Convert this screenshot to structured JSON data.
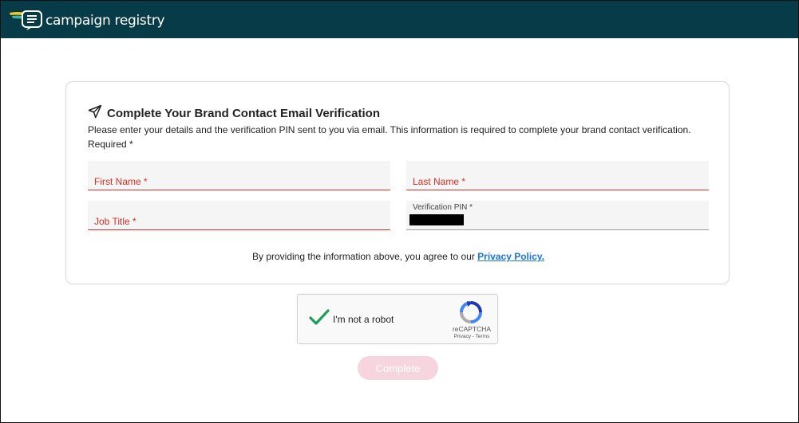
{
  "header": {
    "logo_text": "campaign registry"
  },
  "form": {
    "title": "Complete Your Brand Contact Email Verification",
    "description": "Please enter your details and the verification PIN sent to you via email. This information is required to complete your brand contact verification.",
    "required_note": "Required *",
    "fields": {
      "first_name": "First Name *",
      "last_name": "Last Name *",
      "job_title": "Job Title *",
      "verification_pin": "Verification PIN *"
    },
    "agree_text": "By providing the information above, you agree to our",
    "privacy_link": "Privacy Policy."
  },
  "captcha": {
    "label": "I'm not a robot",
    "brand": "reCAPTCHA",
    "privacy": "Privacy",
    "separator": " - ",
    "terms": "Terms"
  },
  "actions": {
    "complete_label": "Complete"
  },
  "colors": {
    "header_bg": "#073b47",
    "error_red": "#d93025",
    "link_blue": "#1a73e8",
    "button_disabled": "#f7d5df"
  }
}
